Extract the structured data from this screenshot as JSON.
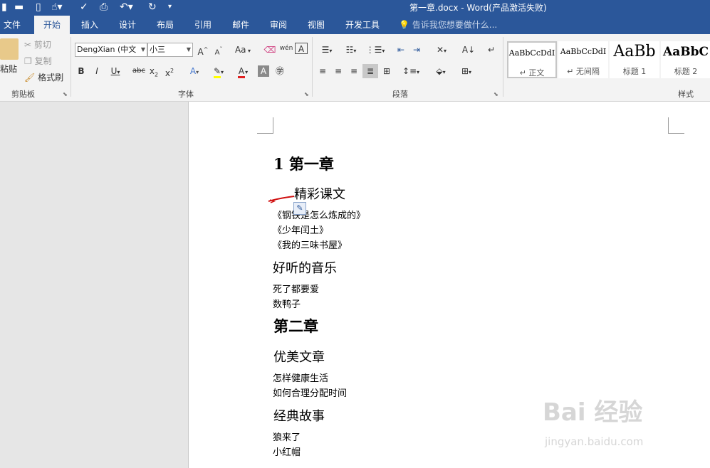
{
  "window": {
    "title": "第一章.docx - Word(产品激活失败)"
  },
  "tabs": [
    {
      "label": "文件"
    },
    {
      "label": "开始"
    },
    {
      "label": "插入"
    },
    {
      "label": "设计"
    },
    {
      "label": "布局"
    },
    {
      "label": "引用"
    },
    {
      "label": "邮件"
    },
    {
      "label": "审阅"
    },
    {
      "label": "视图"
    },
    {
      "label": "开发工具"
    }
  ],
  "active_tab": "开始",
  "tell_me": "告诉我您想要做什么...",
  "clipboard": {
    "paste": "粘贴",
    "cut": "剪切",
    "copy": "复制",
    "format_painter": "格式刷",
    "group_label": "剪贴板"
  },
  "font": {
    "name": "DengXian (中文",
    "size": "小三",
    "group_label": "字体",
    "case_label": "Aa"
  },
  "paragraph": {
    "group_label": "段落"
  },
  "styles": {
    "group_label": "样式",
    "items": [
      {
        "sample": "AaBbCcDdI",
        "name": "↵ 正文",
        "selected": true
      },
      {
        "sample": "AaBbCcDdI",
        "name": "↵ 无间隔"
      },
      {
        "sample": "AaBb",
        "name": "标题 1"
      },
      {
        "sample": "AaBbC",
        "name": "标题 2"
      }
    ]
  },
  "document": {
    "lines": [
      {
        "text": "1   第一章",
        "style": "h1"
      },
      {
        "text": "精彩课文",
        "style": "h2"
      },
      {
        "text": "《钢铁是怎么炼成的》",
        "style": "body"
      },
      {
        "text": "《少年闰土》",
        "style": "body"
      },
      {
        "text": "《我的三味书屋》",
        "style": "body"
      },
      {
        "text": "好听的音乐",
        "style": "h2"
      },
      {
        "text": "死了都要爱",
        "style": "body"
      },
      {
        "text": "数鸭子",
        "style": "body"
      },
      {
        "text": "第二章",
        "style": "h1"
      },
      {
        "text": "优美文章",
        "style": "h2"
      },
      {
        "text": "怎样健康生活",
        "style": "body"
      },
      {
        "text": "如何合理分配时间",
        "style": "body"
      },
      {
        "text": "经典故事",
        "style": "h2"
      },
      {
        "text": "狼来了",
        "style": "body"
      },
      {
        "text": "小红帽",
        "style": "body"
      }
    ]
  },
  "watermark": {
    "text": "Bai 经验",
    "sub": "jingyan.baidu.com"
  },
  "colors": {
    "accent": "#2b579a",
    "ribbon": "#f3f3f3",
    "canvas": "#e6e6e6",
    "highlight": "#ffff00",
    "font_color": "#e02020",
    "annotation": "#d01010"
  }
}
